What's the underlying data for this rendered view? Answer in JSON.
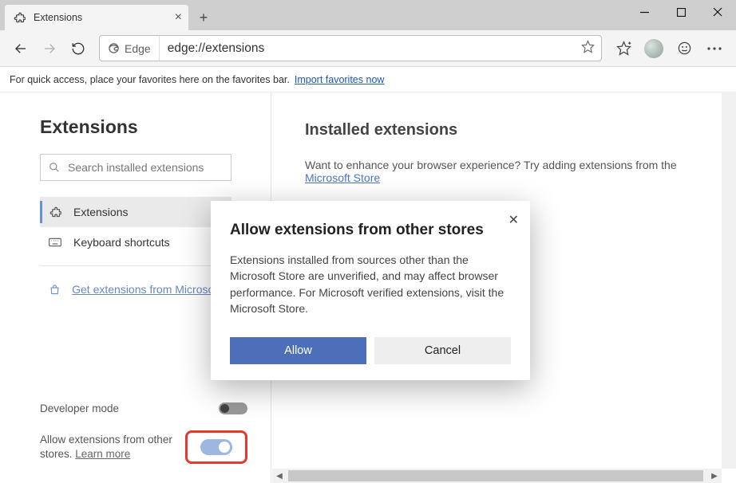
{
  "window": {
    "tab_title": "Extensions"
  },
  "toolbar": {
    "edge_label": "Edge",
    "url": "edge://extensions"
  },
  "favbar": {
    "hint": "For quick access, place your favorites here on the favorites bar.",
    "import_link": "Import favorites now"
  },
  "sidebar": {
    "title": "Extensions",
    "search_placeholder": "Search installed extensions",
    "nav": {
      "extensions": "Extensions",
      "shortcuts": "Keyboard shortcuts",
      "get_extensions": "Get extensions from Microsoft Store"
    },
    "settings": {
      "developer_mode": "Developer mode",
      "allow_other_prefix": "Allow extensions from other stores. ",
      "learn_more": "Learn more"
    }
  },
  "main": {
    "title": "Installed extensions",
    "sub_prefix": "Want to enhance your browser experience? Try adding extensions from the ",
    "sub_link": "Microsoft Store"
  },
  "dialog": {
    "title": "Allow extensions from other stores",
    "body": "Extensions installed from sources other than the Microsoft Store are unverified, and may affect browser performance. For Microsoft verified extensions, visit the Microsoft Store.",
    "allow": "Allow",
    "cancel": "Cancel"
  }
}
